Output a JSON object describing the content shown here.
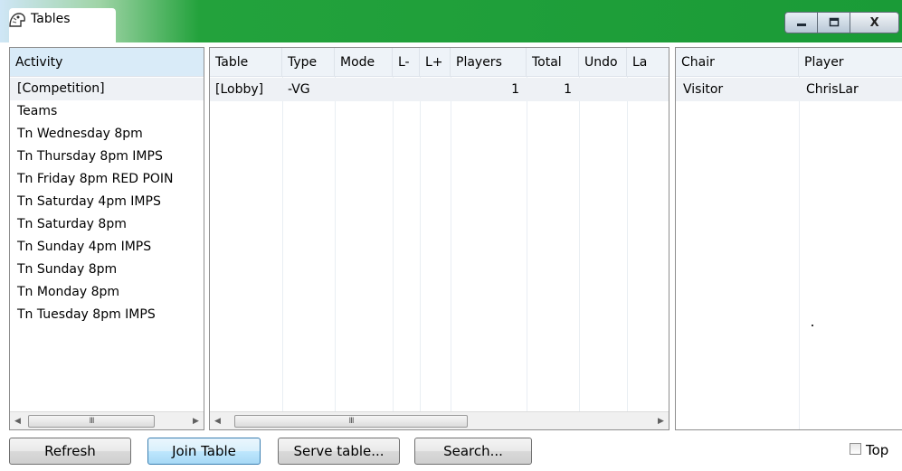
{
  "window": {
    "title": "Tables",
    "icon": "bridge-app-icon",
    "controls": {
      "minimize": "minimize-icon",
      "maximize": "maximize-icon",
      "close_label": "X"
    }
  },
  "activity": {
    "header": "Activity",
    "items": [
      "[Competition]",
      "Teams",
      "Tn Wednesday 8pm",
      "Tn Thursday 8pm IMPS",
      "Tn Friday 8pm RED POIN",
      "Tn Saturday 4pm IMPS",
      "Tn Saturday 8pm",
      "Tn Sunday 4pm IMPS",
      "Tn Sunday 8pm",
      "Tn Monday 8pm",
      "Tn Tuesday 8pm IMPS"
    ],
    "selected_index": 0,
    "scrollbar_grip": "III"
  },
  "tables": {
    "columns": [
      "Table",
      "Type",
      "Mode",
      "L-",
      "L+",
      "Players",
      "Total",
      "Undo",
      "La"
    ],
    "rows": [
      {
        "table": "[Lobby]",
        "type": "-VG",
        "mode": "",
        "lminus": "",
        "lplus": "",
        "players": "1",
        "total": "1",
        "undo": "",
        "la": ""
      }
    ],
    "scrollbar_grip": "III"
  },
  "players": {
    "columns": [
      "Chair",
      "Player"
    ],
    "rows": [
      {
        "chair": "Visitor",
        "player": "ChrisLar"
      }
    ]
  },
  "buttons": {
    "refresh": "Refresh",
    "join_table": "Join Table",
    "serve_table": "Serve table...",
    "search": "Search..."
  },
  "top_checkbox": {
    "label": "Top",
    "checked": false
  },
  "colors": {
    "titlebar_green": "#1a9b37",
    "header_bg": "#eef3f8",
    "selected_row": "#eef1f5",
    "focus_blue": "#3c7fb1"
  }
}
